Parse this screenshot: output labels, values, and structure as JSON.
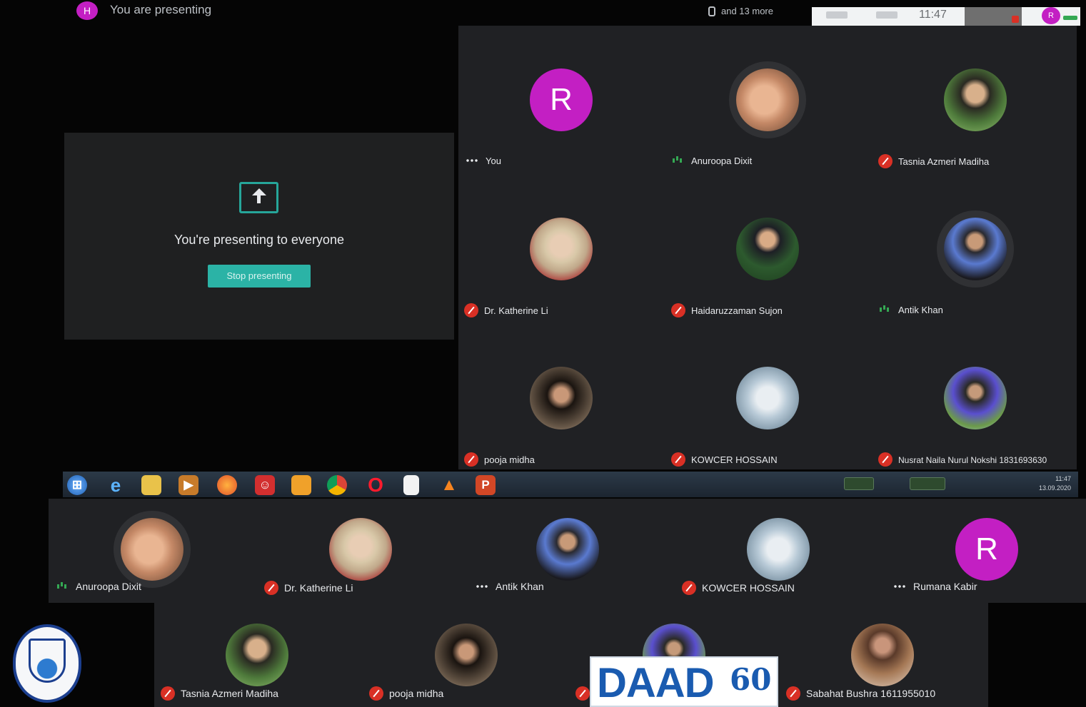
{
  "top_bar": {
    "presenter_initial": "H",
    "presenting_text": "You are presenting",
    "people_more": "and 13 more",
    "time": "11:47",
    "you_initial": "R"
  },
  "presenting": {
    "title": "You're presenting to everyone",
    "stop_button": "Stop presenting"
  },
  "grid_tiles": [
    {
      "name": "You",
      "status": "dots",
      "avatar": "letter",
      "letter": "R"
    },
    {
      "name": "Anuroopa Dixit",
      "status": "speaking",
      "avatar": "ph-hands"
    },
    {
      "name": "Tasnia Azmeri Madiha",
      "status": "muted",
      "avatar": "ph-woman1"
    },
    {
      "name": "Dr. Katherine Li",
      "status": "muted",
      "avatar": "ph-blonde"
    },
    {
      "name": "Haidaruzzaman Sujon",
      "status": "muted",
      "avatar": "ph-suit"
    },
    {
      "name": "Antik Khan",
      "status": "speaking",
      "avatar": "ph-man2"
    },
    {
      "name": "pooja midha",
      "status": "muted",
      "avatar": "ph-curly"
    },
    {
      "name": "KOWCER HOSSAIN",
      "status": "muted",
      "avatar": "ph-love"
    },
    {
      "name": "Nusrat Naila Nurul Nokshi 1831693630",
      "status": "muted",
      "avatar": "ph-blue"
    }
  ],
  "taskbar": {
    "icons": [
      "windows-start",
      "internet-explorer",
      "file-explorer",
      "media-player",
      "firefox",
      "app-red",
      "app-orange",
      "chrome",
      "opera",
      "document",
      "vlc",
      "powerpoint"
    ],
    "tray_time": "11:47",
    "tray_date": "13.09.2020"
  },
  "strip_row1": [
    {
      "name": "Anuroopa Dixit",
      "status": "speaking",
      "avatar": "ph-hands"
    },
    {
      "name": "Dr. Katherine Li",
      "status": "muted",
      "avatar": "ph-blonde"
    },
    {
      "name": "Antik Khan",
      "status": "dots",
      "avatar": "ph-man2"
    },
    {
      "name": "KOWCER HOSSAIN",
      "status": "muted",
      "avatar": "ph-love"
    },
    {
      "name": "Rumana Kabir",
      "status": "dots",
      "avatar": "letter",
      "letter": "R"
    }
  ],
  "strip_row2": [
    {
      "name": "Tasnia Azmeri Madiha",
      "status": "muted",
      "avatar": "ph-woman1"
    },
    {
      "name": "pooja midha",
      "status": "muted",
      "avatar": "ph-curly"
    },
    {
      "name": "",
      "status": "muted",
      "avatar": "ph-blue"
    },
    {
      "name": "Sabahat Bushra 1611955010",
      "status": "muted",
      "avatar": "ph-bushra"
    }
  ],
  "daad": {
    "text": "DAAD",
    "badge": "60"
  },
  "colors": {
    "accent": "#2bb3a6",
    "avatar_purple": "#c31fc3",
    "muted_red": "#d93025",
    "speaking_green": "#34a853",
    "tile_bg": "#202124"
  }
}
